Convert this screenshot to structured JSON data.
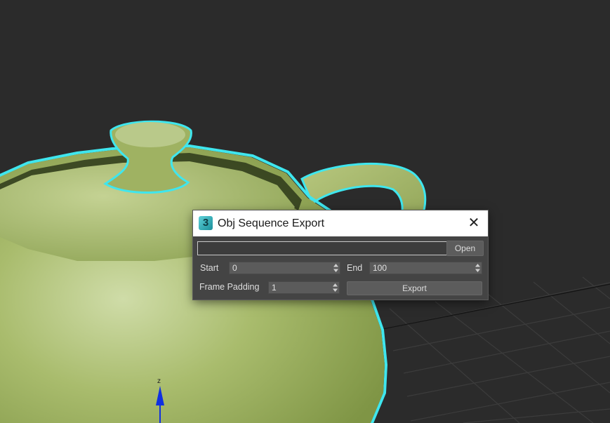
{
  "dialog": {
    "title": "Obj Sequence Export",
    "app_icon_glyph": "3",
    "close_glyph": "✕",
    "path_value": "",
    "open_label": "Open",
    "start_label": "Start",
    "start_value": "0",
    "end_label": "End",
    "end_value": "100",
    "padding_label": "Frame Padding",
    "padding_value": "1",
    "export_label": "Export"
  },
  "viewport": {
    "axis_label": "z",
    "object": "teapot",
    "selection_color": "#3fe6ee",
    "object_color": "#a7b86c",
    "background_color": "#2b2b2b",
    "gizmo_color": "#1030e0"
  }
}
